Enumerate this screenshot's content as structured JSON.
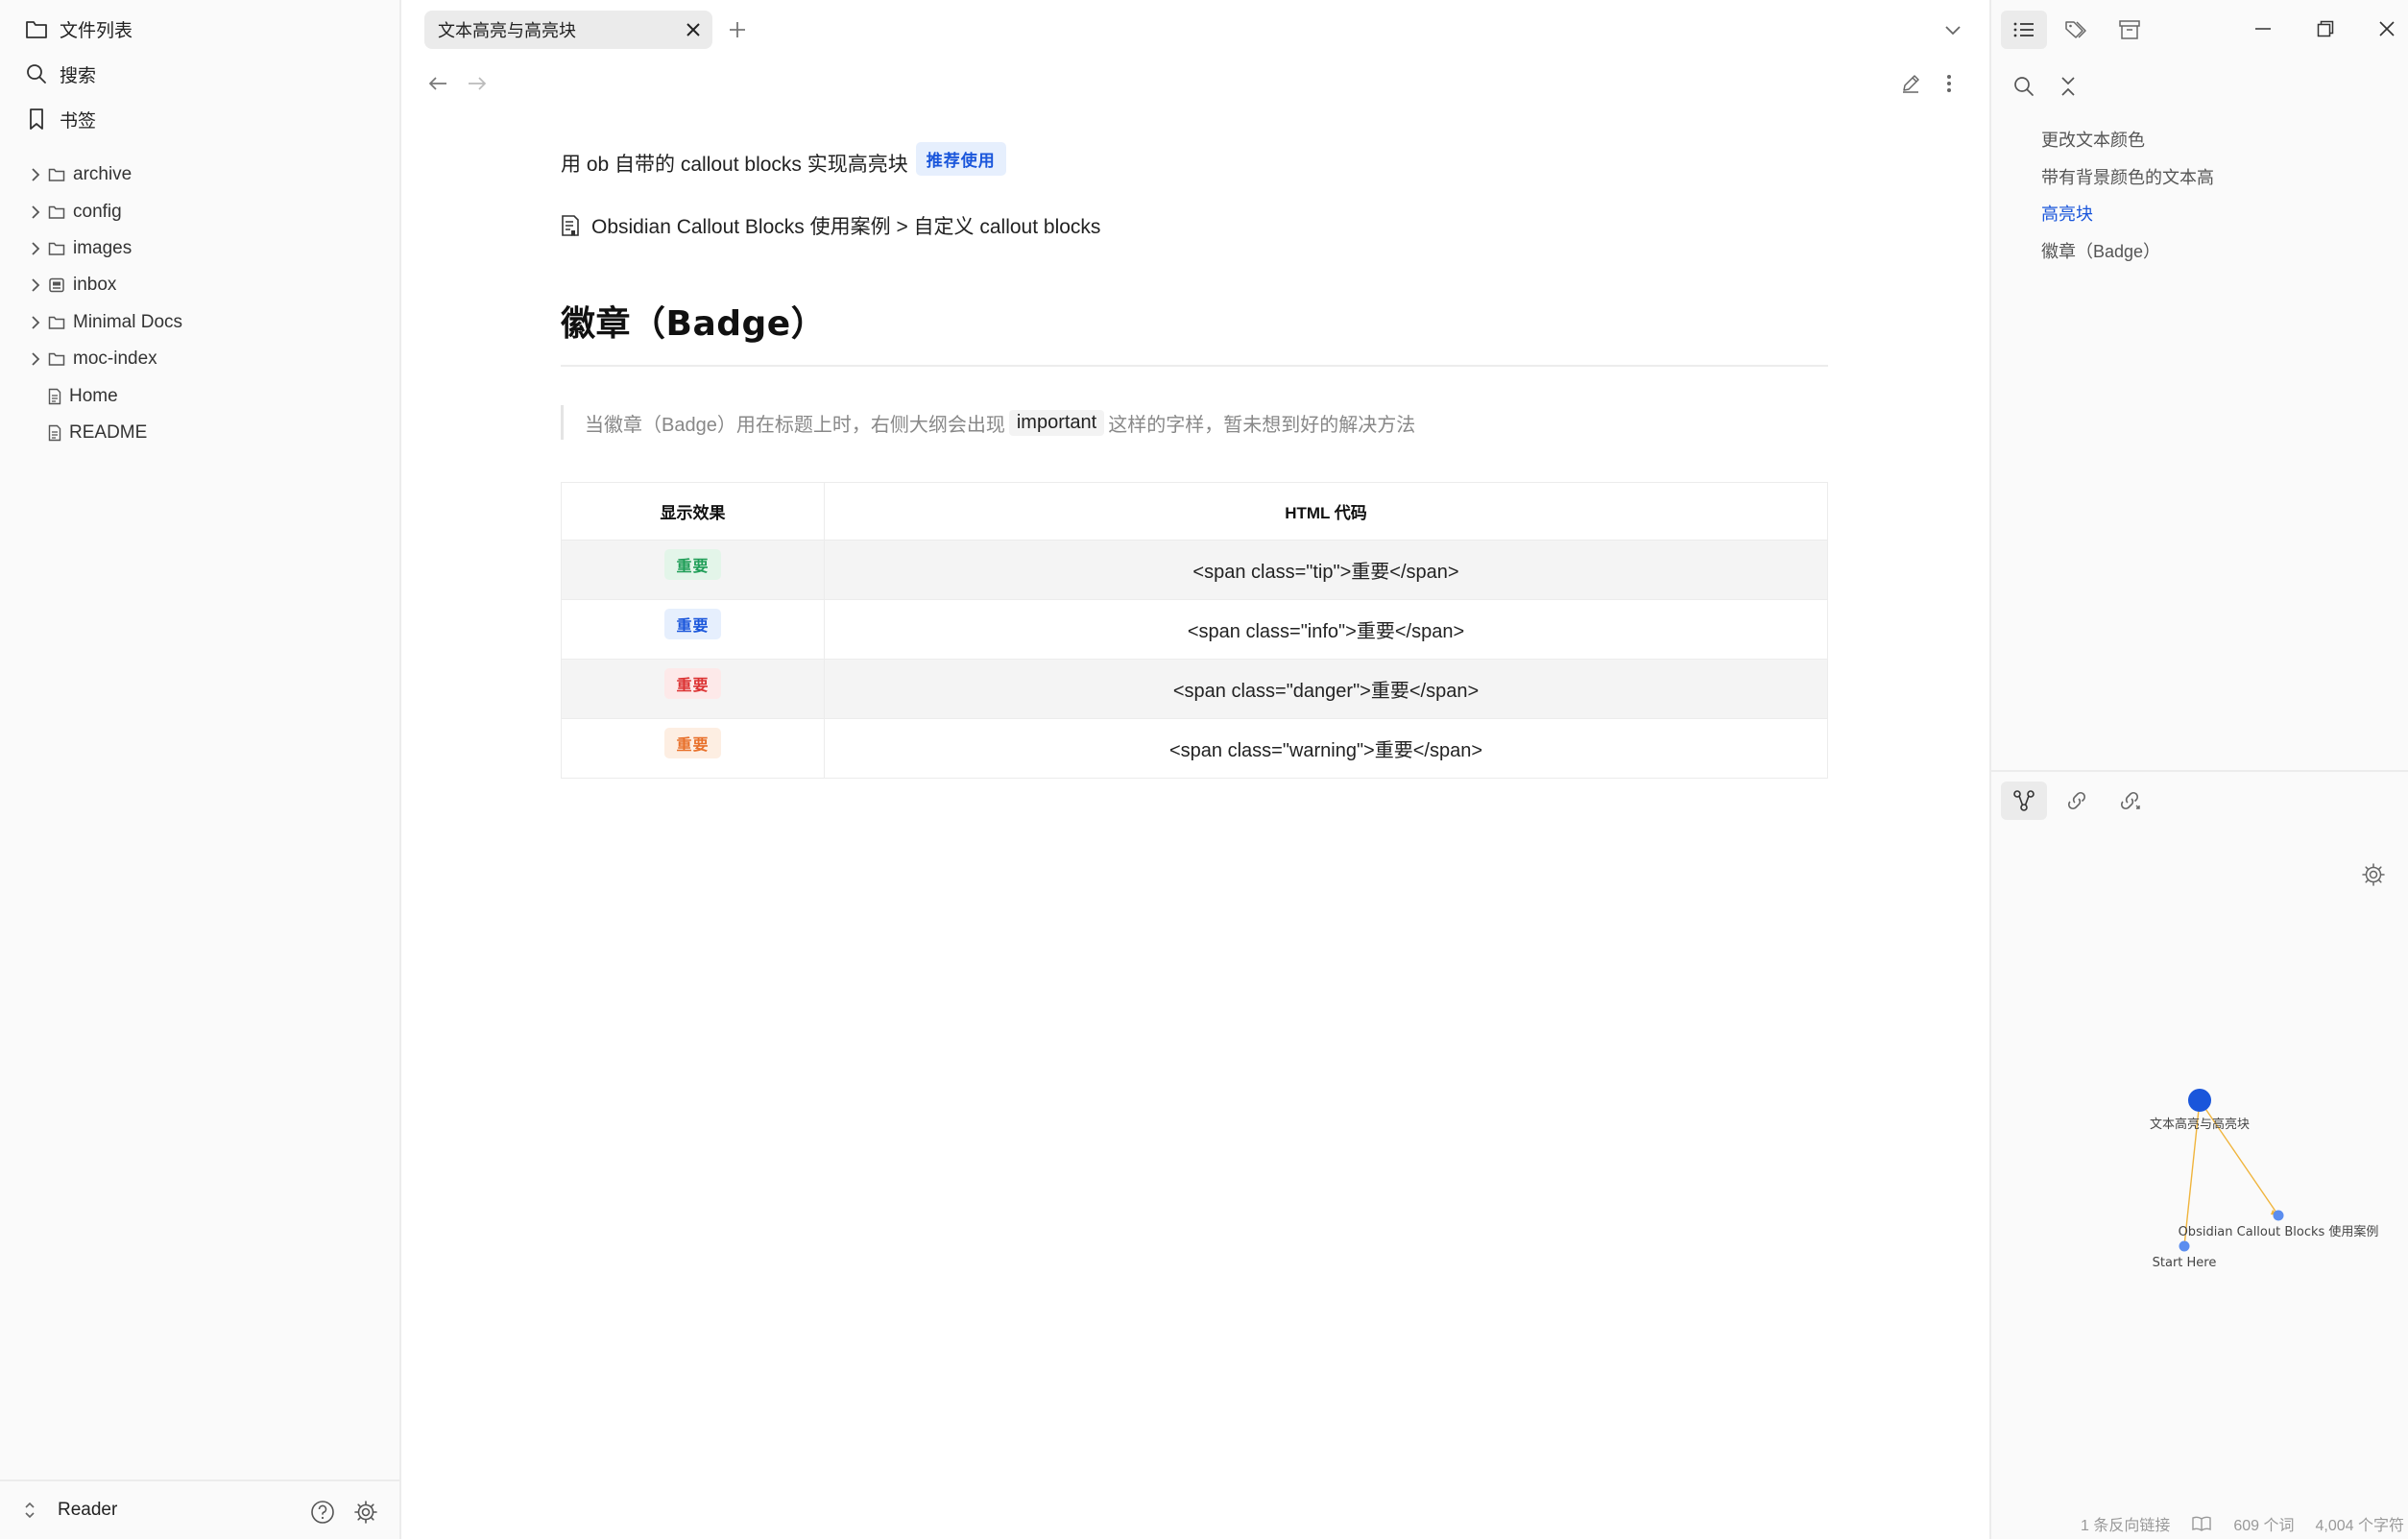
{
  "left_sidebar": {
    "nav": {
      "files": "文件列表",
      "search": "搜索",
      "bookmarks": "书签"
    },
    "tree": [
      {
        "name": "archive",
        "type": "folder"
      },
      {
        "name": "config",
        "type": "folder"
      },
      {
        "name": "images",
        "type": "folder"
      },
      {
        "name": "inbox",
        "type": "folder-special"
      },
      {
        "name": "Minimal Docs",
        "type": "folder"
      },
      {
        "name": "moc-index",
        "type": "folder"
      },
      {
        "name": "Home",
        "type": "file"
      },
      {
        "name": "README",
        "type": "file"
      }
    ],
    "vault_name": "Reader"
  },
  "tab": {
    "title": "文本高亮与高亮块"
  },
  "note": {
    "line1_text": "用 ob 自带的 callout blocks 实现高亮块",
    "line1_badge": "推荐使用",
    "link_text": "Obsidian Callout Blocks 使用案例 > 自定义 callout blocks",
    "heading": "徽章（Badge）",
    "quote_before": "当徽章（Badge）用在标题上时，右侧大纲会出现",
    "quote_code": "important",
    "quote_after": "这样的字样，暂未想到好的解决方法",
    "table": {
      "headers": [
        "显示效果",
        "HTML 代码"
      ],
      "rows": [
        {
          "badge": "重要",
          "kind": "tip",
          "code": "<span class=\"tip\">重要</span>"
        },
        {
          "badge": "重要",
          "kind": "info",
          "code": "<span class=\"info\">重要</span>"
        },
        {
          "badge": "重要",
          "kind": "danger",
          "code": "<span class=\"danger\">重要</span>"
        },
        {
          "badge": "重要",
          "kind": "warning",
          "code": "<span class=\"warning\">重要</span>"
        }
      ]
    }
  },
  "outline": {
    "items": [
      "更改文本颜色",
      "带有背景颜色的文本高",
      "高亮块",
      "徽章（Badge）"
    ],
    "active_index": 2
  },
  "graph": {
    "nodes": [
      {
        "label": "文本高亮与高亮块",
        "current": true
      },
      {
        "label": "Obsidian Callout Blocks 使用案例",
        "current": false
      },
      {
        "label": "Start Here",
        "current": false
      }
    ]
  },
  "status_bar": {
    "backlinks": "1 条反向链接",
    "words": "609 个词",
    "chars": "4,004 个字符"
  },
  "colors": {
    "accent": "#1a56db",
    "graph_node_current": "#1a56db",
    "graph_node": "#5b8def",
    "graph_edge": "#f0b43c",
    "tip": "#1f9e57",
    "info": "#1a56db",
    "danger": "#dc3232",
    "warning": "#e8702a"
  }
}
